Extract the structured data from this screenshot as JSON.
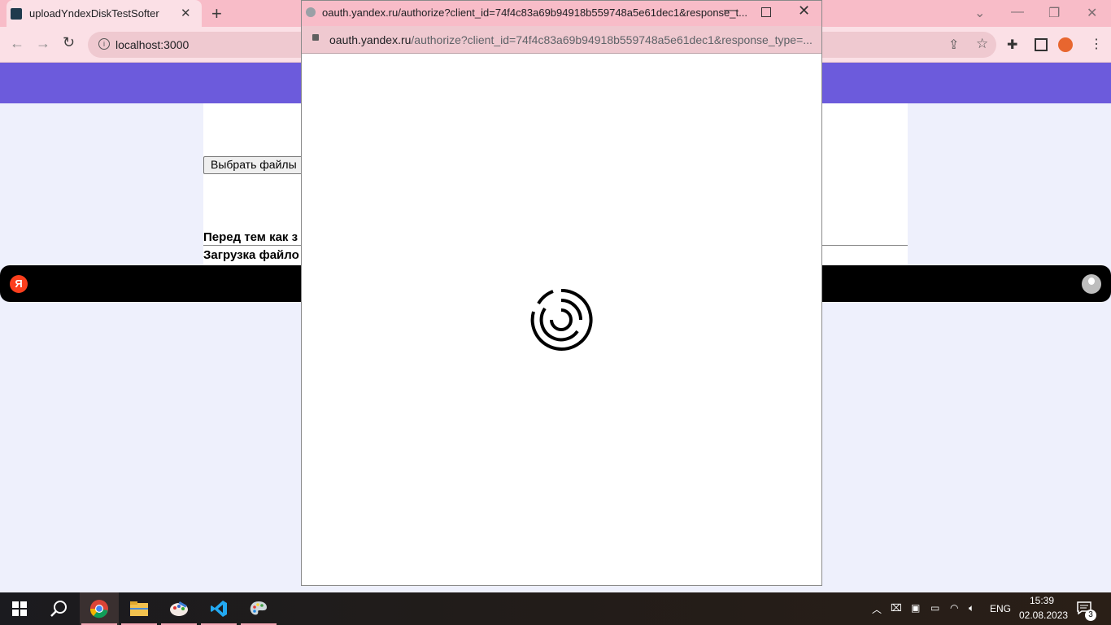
{
  "browser": {
    "tab_title": "uploadYndexDiskTestSofter",
    "tab_close": "✕",
    "new_tab": "+",
    "url": "localhost:3000",
    "window_controls": {
      "collapse": "⌄",
      "minimize": "—",
      "restore": "❐",
      "close": "✕"
    }
  },
  "page": {
    "choose_files_button": "Выбрать файлы",
    "text_before": "Перед тем как з",
    "text_upload": "Загрузка файло",
    "yandex_logo": "Я"
  },
  "popup": {
    "title": "oauth.yandex.ru/authorize?client_id=74f4c83a69b94918b559748a5e61dec1&response_t...",
    "url_host": "oauth.yandex.ru",
    "url_rest": "/authorize?client_id=74f4c83a69b94918b559748a5e61dec1&response_type=...",
    "minimize": "—",
    "close": "✕",
    "state": "loading"
  },
  "taskbar": {
    "language": "ENG",
    "time": "15:39",
    "date": "02.08.2023",
    "notifications_count": "3",
    "apps": [
      "start",
      "search",
      "chrome",
      "file-explorer",
      "paint",
      "vscode",
      "palette"
    ],
    "active_app": "chrome"
  },
  "colors": {
    "tabstrip": "#f8bcc8",
    "purple_band": "#6c5bdc",
    "page_background": "#eef0fc"
  }
}
